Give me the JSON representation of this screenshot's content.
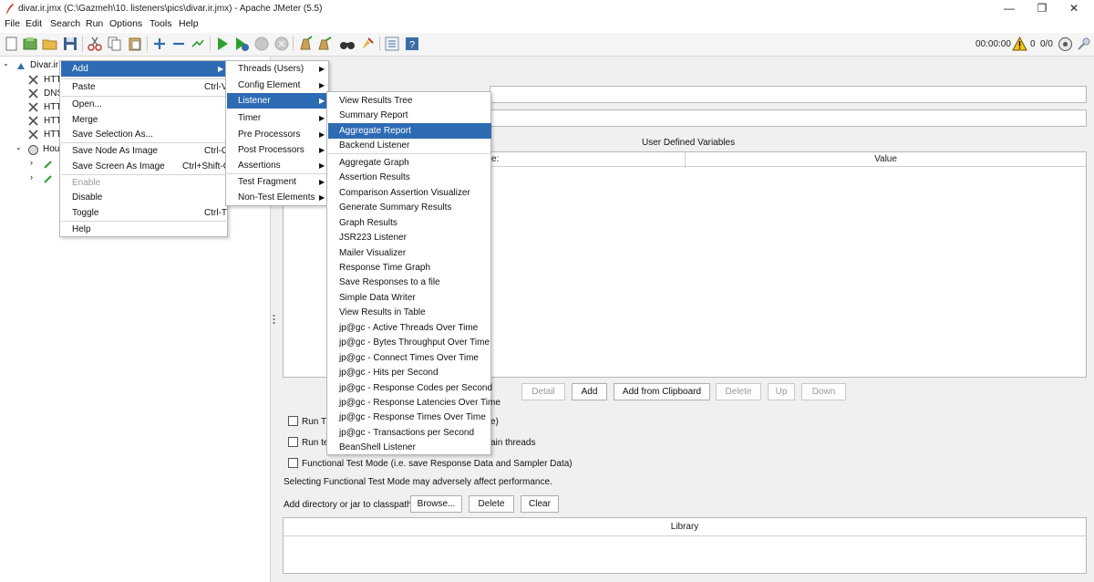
{
  "window": {
    "title": "divar.ir.jmx (C:\\Gazmeh\\10. listeners\\pics\\divar.ir.jmx) - Apache JMeter (5.5)",
    "controls": {
      "minimize": "—",
      "maximize": "❐",
      "close": "✕"
    }
  },
  "menubar": [
    {
      "label": "File"
    },
    {
      "label": "Edit"
    },
    {
      "label": "Search"
    },
    {
      "label": "Run"
    },
    {
      "label": "Options"
    },
    {
      "label": "Tools"
    },
    {
      "label": "Help"
    }
  ],
  "status": {
    "timer": "00:00:00",
    "warnings": "0",
    "threads": "0/0"
  },
  "tree": {
    "root": "Divar.ir",
    "items": [
      "HTT",
      "DNS",
      "HTT",
      "HTT",
      "HTT"
    ],
    "thread_group": "Hou"
  },
  "context_menu": {
    "items": [
      {
        "label": "Add",
        "shortcut": "",
        "submenu": true,
        "highlight": true
      },
      {
        "label": "Paste",
        "shortcut": "Ctrl-V"
      },
      {
        "label": "Open..."
      },
      {
        "label": "Merge"
      },
      {
        "label": "Save Selection As..."
      },
      {
        "label": "Save Node As Image",
        "shortcut": "Ctrl-G"
      },
      {
        "label": "Save Screen As Image",
        "shortcut": "Ctrl+Shift-G"
      },
      {
        "label": "Enable",
        "disabled": true
      },
      {
        "label": "Disable"
      },
      {
        "label": "Toggle",
        "shortcut": "Ctrl-T"
      },
      {
        "label": "Help"
      }
    ]
  },
  "add_submenu": {
    "items": [
      {
        "label": "Threads (Users)"
      },
      {
        "label": "Config Element"
      },
      {
        "label": "Listener",
        "highlight": true
      },
      {
        "label": "Timer"
      },
      {
        "label": "Pre Processors"
      },
      {
        "label": "Post Processors"
      },
      {
        "label": "Assertions"
      },
      {
        "label": "Test Fragment"
      },
      {
        "label": "Non-Test Elements"
      }
    ]
  },
  "listener_submenu": {
    "items": [
      "View Results Tree",
      "Summary Report",
      "Aggregate Report",
      "Backend Listener",
      "Aggregate Graph",
      "Assertion Results",
      "Comparison Assertion Visualizer",
      "Generate Summary Results",
      "Graph Results",
      "JSR223 Listener",
      "Mailer Visualizer",
      "Response Time Graph",
      "Save Responses to a file",
      "Simple Data Writer",
      "View Results in Table",
      "jp@gc - Active Threads Over Time",
      "jp@gc - Bytes Throughput Over Time",
      "jp@gc - Connect Times Over Time",
      "jp@gc - Hits per Second",
      "jp@gc - Response Codes per Second",
      "jp@gc - Response Latencies Over Time",
      "jp@gc - Response Times Over Time",
      "jp@gc - Transactions per Second",
      "BeanShell Listener"
    ],
    "highlight_index": 2
  },
  "right_panel": {
    "udv_title": "User Defined Variables",
    "col_name_partial": "e:",
    "col_value": "Value",
    "buttons": {
      "detail": "Detail",
      "add": "Add",
      "add_clipboard": "Add from Clipboard",
      "delete": "Delete",
      "up": "Up",
      "down": "Down"
    },
    "run_tg_partial": "Run Th",
    "run_tg_suffix": "e)",
    "run_teardown_partial": "Run te",
    "run_teardown_suffix": "ain threads",
    "functional_mode": "Functional Test Mode (i.e. save Response Data and Sampler Data)",
    "functional_note": "Selecting Functional Test Mode may adversely affect performance.",
    "classpath_label": "Add directory or jar to classpath",
    "browse": "Browse...",
    "cp_delete": "Delete",
    "clear": "Clear",
    "library_header": "Library"
  },
  "colors": {
    "highlight": "#2d6bb3",
    "accent_green": "#2e9e2e"
  }
}
